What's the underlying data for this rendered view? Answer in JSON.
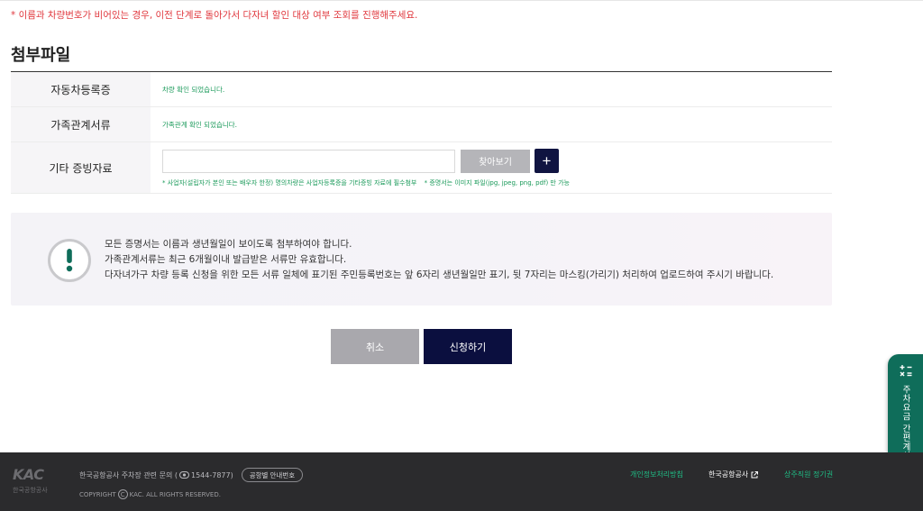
{
  "notice": "* 이름과 차량번호가 비어있는 경우, 이전 단계로 돌아가서 다자녀 할인 대상 여부 조회를 진행해주세요.",
  "section": {
    "title": "첨부파일"
  },
  "attachments": {
    "rows": [
      {
        "label": "자동차등록증",
        "status": "차량 확인 되었습니다."
      },
      {
        "label": "가족관계서류",
        "status": "가족관계 확인 되었습니다."
      },
      {
        "label": "기타 증빙자료",
        "input_value": "",
        "browse_label": "찾아보기",
        "add_label": "+"
      }
    ],
    "hints": [
      "* 사업자(설립자가 본인 또는 배우자 한정) 명의차량은 사업자등록증을 기타증빙 자료에 필수첨부",
      "* 증명서는 이미지 파일(jpg, jpeg, png, pdf) 만 가능"
    ]
  },
  "info": {
    "icon": "exclamation-icon",
    "lines": [
      "모든 증명서는 이름과 생년월일이 보이도록 첨부하여야 합니다.",
      "가족관계서류는 최근 6개월이내 발급받은 서류만 유효합니다.",
      "다자녀가구 차량 등록 신청을 위한 모든 서류 일체에 표기된 주민등록번호는 앞 6자리 생년월일만 표기, 뒷 7자리는 마스킹(가리기) 처리하여 업로드하여 주시기 바랍니다."
    ]
  },
  "actions": {
    "cancel_label": "취소",
    "submit_label": "신청하기"
  },
  "side_widget": {
    "label": "주차요금 간편계산",
    "icon": "calculator-icon"
  },
  "footer": {
    "logo_text": "KAC",
    "logo_sub": "한국공항공사",
    "contact_prefix": "한국공항공사 주차장 관련 문의 (",
    "phone_icon": "phone-icon",
    "phone": "1544-7877",
    "contact_suffix": ")",
    "guide_button": "공항별 안내번호",
    "copyright_prefix": "COPYRIGHT",
    "copyright_c": "C",
    "copyright_suffix": "KAC. ALL RIGHTS RESERVED.",
    "links": {
      "privacy": "개인정보처리방침",
      "kac": "한국공항공사",
      "season_pass": "상주직원 정기권"
    }
  },
  "colors": {
    "navy": "#0b0f3f",
    "green_text": "#1a9a5a",
    "notice_red": "#e0383e",
    "footer_bg": "#2b2b2d",
    "widget_green": "#0f6d5a"
  }
}
